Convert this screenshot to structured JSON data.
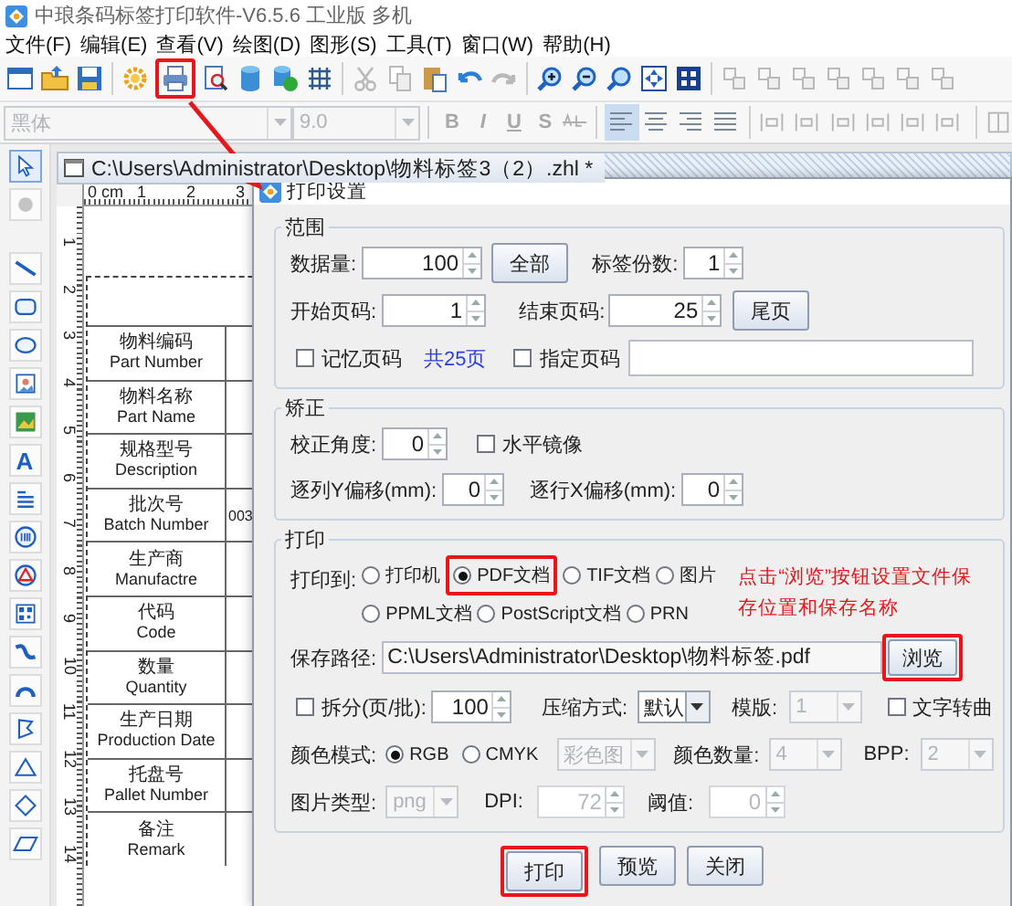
{
  "app_title": "中琅条码标签打印软件-V6.5.6 工业版 多机",
  "menu": [
    "文件(F)",
    "编辑(E)",
    "查看(V)",
    "绘图(D)",
    "图形(S)",
    "工具(T)",
    "窗口(W)",
    "帮助(H)"
  ],
  "toolbar": {
    "groups": [
      [
        {
          "kind": "window",
          "disabled": false,
          "callout": false
        },
        {
          "kind": "open",
          "disabled": false,
          "callout": false
        },
        {
          "kind": "save",
          "disabled": false,
          "callout": false
        }
      ],
      [
        {
          "kind": "gear",
          "disabled": false,
          "callout": false
        },
        {
          "kind": "print",
          "disabled": false,
          "callout": true
        },
        {
          "kind": "preview",
          "disabled": false,
          "callout": false
        },
        {
          "kind": "database",
          "disabled": false,
          "callout": false
        },
        {
          "kind": "dbcheck",
          "disabled": false,
          "callout": false
        },
        {
          "kind": "grid",
          "disabled": false,
          "callout": false
        }
      ],
      [
        {
          "kind": "cut",
          "disabled": true,
          "callout": false
        },
        {
          "kind": "copy",
          "disabled": true,
          "callout": false
        },
        {
          "kind": "paste",
          "disabled": false,
          "callout": false
        },
        {
          "kind": "undo",
          "disabled": false,
          "callout": false
        },
        {
          "kind": "redo",
          "disabled": true,
          "callout": false
        }
      ],
      [
        {
          "kind": "zoomin",
          "disabled": false,
          "callout": false
        },
        {
          "kind": "zoomout",
          "disabled": false,
          "callout": false
        },
        {
          "kind": "zoom",
          "disabled": false,
          "callout": false
        },
        {
          "kind": "fit",
          "disabled": false,
          "callout": false
        },
        {
          "kind": "fitall",
          "disabled": false,
          "callout": false
        }
      ],
      [
        {
          "kind": "arrange",
          "disabled": true,
          "callout": false
        },
        {
          "kind": "arrange",
          "disabled": true,
          "callout": false
        },
        {
          "kind": "arrange",
          "disabled": true,
          "callout": false
        },
        {
          "kind": "arrange",
          "disabled": true,
          "callout": false
        },
        {
          "kind": "arrange",
          "disabled": true,
          "callout": false
        },
        {
          "kind": "arrange",
          "disabled": true,
          "callout": false
        },
        {
          "kind": "arrange",
          "disabled": true,
          "callout": false
        }
      ]
    ]
  },
  "format_bar": {
    "font": "黑体",
    "size": "9.0",
    "styles": [
      {
        "label": "B",
        "disabled": true
      },
      {
        "label": "I",
        "disabled": true
      },
      {
        "label": "U",
        "disabled": true
      },
      {
        "label": "S",
        "disabled": true
      }
    ],
    "align": [
      {
        "selected": true
      },
      {
        "selected": false
      },
      {
        "selected": false
      },
      {
        "selected": false
      }
    ]
  },
  "palette": [
    {
      "kind": "pointer",
      "selected": true,
      "disabled": false
    },
    {
      "kind": "eraser",
      "selected": false,
      "disabled": true
    },
    {
      "kind": "line",
      "selected": false,
      "disabled": false
    },
    {
      "kind": "rect",
      "selected": false,
      "disabled": false
    },
    {
      "kind": "ellipse",
      "selected": false,
      "disabled": false
    },
    {
      "kind": "image",
      "selected": false,
      "disabled": false
    },
    {
      "kind": "picture",
      "selected": false,
      "disabled": false
    },
    {
      "kind": "text",
      "label": "A",
      "selected": false,
      "disabled": false
    },
    {
      "kind": "richtext",
      "selected": false,
      "disabled": false
    },
    {
      "kind": "barcode",
      "selected": false,
      "disabled": false
    },
    {
      "kind": "warning",
      "selected": false,
      "disabled": false
    },
    {
      "kind": "qr",
      "selected": false,
      "disabled": false
    },
    {
      "kind": "curve",
      "selected": false,
      "disabled": false
    },
    {
      "kind": "arc",
      "selected": false,
      "disabled": false
    },
    {
      "kind": "poly",
      "selected": false,
      "disabled": false
    },
    {
      "kind": "triangle",
      "selected": false,
      "disabled": false
    },
    {
      "kind": "diamond",
      "selected": false,
      "disabled": false
    },
    {
      "kind": "parallelogram",
      "selected": false,
      "disabled": false
    }
  ],
  "document": {
    "title": "C:\\Users\\Administrator\\Desktop\\物料标签3（2）.zhl *",
    "h_ruler": [
      "0 cm",
      "1",
      "2",
      "3"
    ],
    "v_ruler": [
      "1",
      "2",
      "3",
      "4",
      "5",
      "6",
      "7",
      "8",
      "9",
      "10",
      "11",
      "12",
      "13",
      "14"
    ],
    "label_rows": [
      {
        "cn": "物料编码",
        "en": "Part Number"
      },
      {
        "cn": "物料名称",
        "en": "Part Name"
      },
      {
        "cn": "规格型号",
        "en": "Description"
      },
      {
        "cn": "批次号",
        "en": "Batch Number",
        "value": "003"
      },
      {
        "cn": "生产商",
        "en": "Manufactre"
      },
      {
        "cn": "代码",
        "en": "Code"
      },
      {
        "cn": "数量",
        "en": "Quantity"
      },
      {
        "cn": "生产日期",
        "en": "Production Date"
      },
      {
        "cn": "托盘号",
        "en": "Pallet Number"
      },
      {
        "cn": "备注",
        "en": "Remark"
      }
    ]
  },
  "dialog": {
    "title": "打印设置",
    "range": {
      "legend": "范围",
      "data_count": {
        "label": "数据量:",
        "value": "100"
      },
      "all_button": "全部",
      "copies": {
        "label": "标签份数:",
        "value": "1"
      },
      "start_page": {
        "label": "开始页码:",
        "value": "1"
      },
      "end_page": {
        "label": "结束页码:",
        "value": "25"
      },
      "last_button": "尾页",
      "remember": {
        "label": "记忆页码",
        "checked": false
      },
      "total": "共25页",
      "specify": {
        "label": "指定页码",
        "checked": false
      }
    },
    "correction": {
      "legend": "矫正",
      "angle": {
        "label": "校正角度:",
        "value": "0"
      },
      "mirror": {
        "label": "水平镜像",
        "checked": false
      },
      "y_offset": {
        "label": "逐列Y偏移(mm):",
        "value": "0"
      },
      "x_offset": {
        "label": "逐行X偏移(mm):",
        "value": "0"
      }
    },
    "print": {
      "legend": "打印",
      "target_label": "打印到:",
      "targets": [
        {
          "label": "打印机",
          "selected": false,
          "callout": false
        },
        {
          "label": "PDF文档",
          "selected": true,
          "callout": true
        },
        {
          "label": "TIF文档",
          "selected": false,
          "callout": false
        },
        {
          "label": "图片",
          "selected": false,
          "callout": false
        },
        {
          "label": "PPML文档",
          "selected": false,
          "callout": false
        },
        {
          "label": "PostScript文档",
          "selected": false,
          "callout": false
        },
        {
          "label": "PRN",
          "selected": false,
          "callout": false
        }
      ],
      "note": "点击“浏览”按钮设置文件保存位置和保存名称",
      "save_path": {
        "label": "保存路径:",
        "value": "C:\\Users\\Administrator\\Desktop\\物料标签.pdf"
      },
      "browse_button": {
        "label": "浏览",
        "callout": true
      },
      "split": {
        "label": "拆分(页/批):",
        "checked": false,
        "value": "100"
      },
      "compression": {
        "label": "压缩方式:",
        "value": "默认",
        "disabled": false
      },
      "template": {
        "label": "模版:",
        "value": "1",
        "disabled": true
      },
      "text_to_curve": {
        "label": "文字转曲",
        "checked": false
      },
      "color_mode": {
        "label": "颜色模式:",
        "options": [
          {
            "label": "RGB",
            "selected": true
          },
          {
            "label": "CMYK",
            "selected": false
          }
        ]
      },
      "color_type": {
        "value": "彩色图",
        "disabled": true
      },
      "color_count": {
        "label": "颜色数量:",
        "value": "4",
        "disabled": true
      },
      "bpp": {
        "label": "BPP:",
        "value": "2",
        "disabled": true
      },
      "image_type": {
        "label": "图片类型:",
        "value": "png",
        "disabled": true
      },
      "dpi": {
        "label": "DPI:",
        "value": "72",
        "disabled": true
      },
      "threshold": {
        "label": "阈值:",
        "value": "0",
        "disabled": true
      }
    },
    "buttons": [
      {
        "label": "打印",
        "callout": true
      },
      {
        "label": "预览",
        "callout": false
      },
      {
        "label": "关闭",
        "callout": false
      }
    ]
  }
}
